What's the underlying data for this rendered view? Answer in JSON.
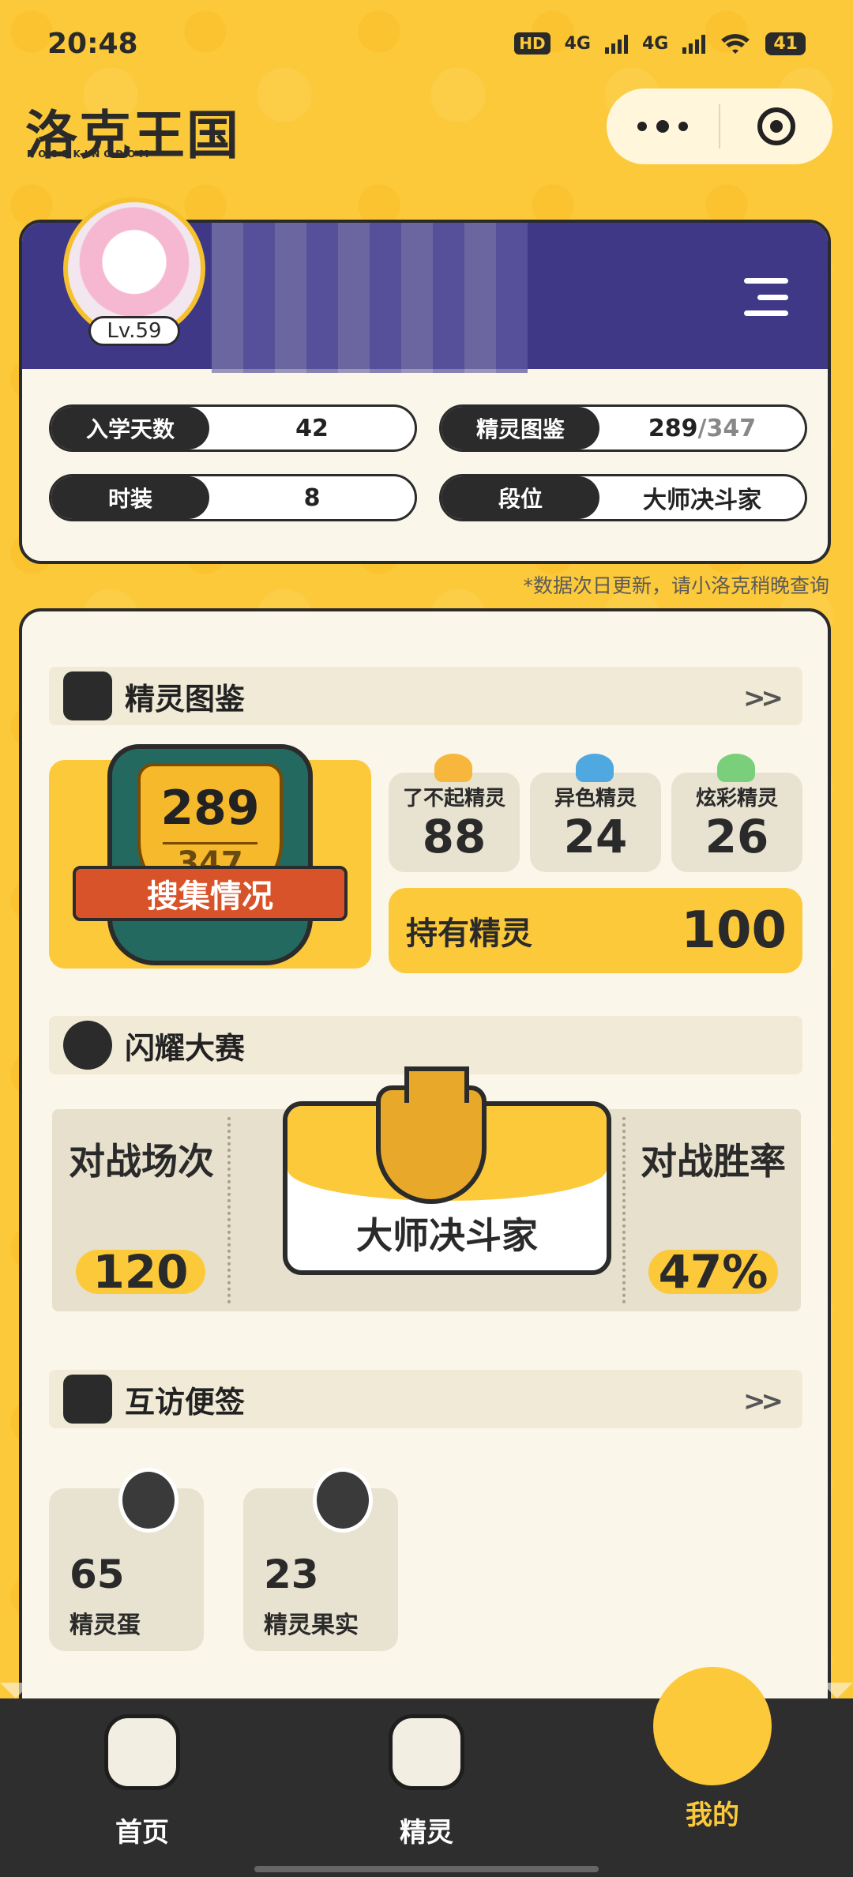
{
  "status_bar": {
    "time": "20:48",
    "hd": "HD",
    "net1": "4G",
    "net2": "4G",
    "battery": "41"
  },
  "header": {
    "logo_text": "洛克王国",
    "logo_sub": "ROCOKINGDOM"
  },
  "profile": {
    "level": "Lv.59",
    "stats": [
      {
        "label": "入学天数",
        "value": "42"
      },
      {
        "label": "精灵图鉴",
        "value": "289",
        "total": "/347"
      },
      {
        "label": "时装",
        "value": "8"
      },
      {
        "label": "段位",
        "value": "大师决斗家"
      }
    ],
    "note": "*数据次日更新，请小洛克稍晚查询"
  },
  "pokedex": {
    "title": "精灵图鉴",
    "collected": "289",
    "total": "347",
    "ribbon": "搜集情况",
    "cards": [
      {
        "label": "了不起精灵",
        "value": "88"
      },
      {
        "label": "异色精灵",
        "value": "24"
      },
      {
        "label": "炫彩精灵",
        "value": "26"
      }
    ],
    "owned_label": "持有精灵",
    "owned_value": "100"
  },
  "battle": {
    "title": "闪耀大赛",
    "matches_label": "对战场次",
    "matches_value": "120",
    "rank_name": "大师决斗家",
    "winrate_label": "对战胜率",
    "winrate_value": "47%"
  },
  "visits": {
    "title": "互访便签",
    "items": [
      {
        "value": "65",
        "label": "精灵蛋"
      },
      {
        "value": "23",
        "label": "精灵果实"
      }
    ]
  },
  "nav": {
    "items": [
      {
        "label": "首页"
      },
      {
        "label": "精灵"
      },
      {
        "label": "我的"
      }
    ]
  },
  "colors": {
    "brand_yellow": "#FCC93A",
    "banner_purple": "#3f3886",
    "dark": "#2b2b2b",
    "cream": "#fbf6ea"
  }
}
